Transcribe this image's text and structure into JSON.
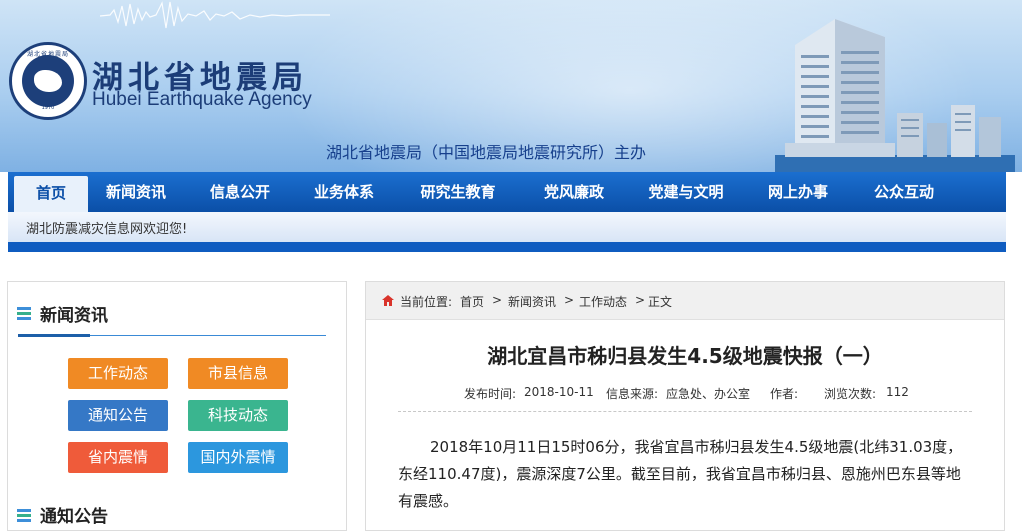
{
  "header": {
    "logo_ring_text": "湖北省地震局",
    "logo_year": "1970",
    "title_cn": "湖北省地震局",
    "title_en": "Hubei Earthquake Agency",
    "sponsor": "湖北省地震局（中国地震局地震研究所）主办"
  },
  "nav": {
    "items": [
      {
        "label": "首页"
      },
      {
        "label": "新闻资讯"
      },
      {
        "label": "信息公开"
      },
      {
        "label": "业务体系"
      },
      {
        "label": "研究生教育"
      },
      {
        "label": "党风廉政"
      },
      {
        "label": "党建与文明"
      },
      {
        "label": "网上办事"
      },
      {
        "label": "公众互动"
      }
    ]
  },
  "notice": {
    "text": "湖北防震减灾信息网欢迎您!"
  },
  "sidebar": {
    "news_title": "新闻资讯",
    "buttons": [
      {
        "label": "工作动态",
        "color": "#f08a24"
      },
      {
        "label": "市县信息",
        "color": "#f08a24"
      },
      {
        "label": "通知公告",
        "color": "#3578c6"
      },
      {
        "label": "科技动态",
        "color": "#3ab58f"
      },
      {
        "label": "省内震情",
        "color": "#ef5b3a"
      },
      {
        "label": "国内外震情",
        "color": "#2c97de"
      }
    ],
    "notice_title": "通知公告"
  },
  "breadcrumb": {
    "prefix": "当前位置:",
    "items": [
      "首页",
      "新闻资讯",
      "工作动态",
      "正文"
    ],
    "separator": ">"
  },
  "article": {
    "title": "湖北宜昌市秭归县发生4.5级地震快报（一）",
    "publish_label": "发布时间:",
    "publish_date": "2018-10-11",
    "source_label": "信息来源:",
    "source": "应急处、办公室",
    "author_label": "作者:",
    "author": "",
    "views_label": "浏览次数:",
    "views": "112",
    "body": "2018年10月11日15时06分，我省宜昌市秭归县发生4.5级地震(北纬31.03度，东经110.47度)，震源深度7公里。截至目前，我省宜昌市秭归县、恩施州巴东县等地有震感。"
  },
  "colors": {
    "nav_blue": "#0b4fa7",
    "header_text": "#1c3d78",
    "accent_blue": "#3a8ad6"
  }
}
